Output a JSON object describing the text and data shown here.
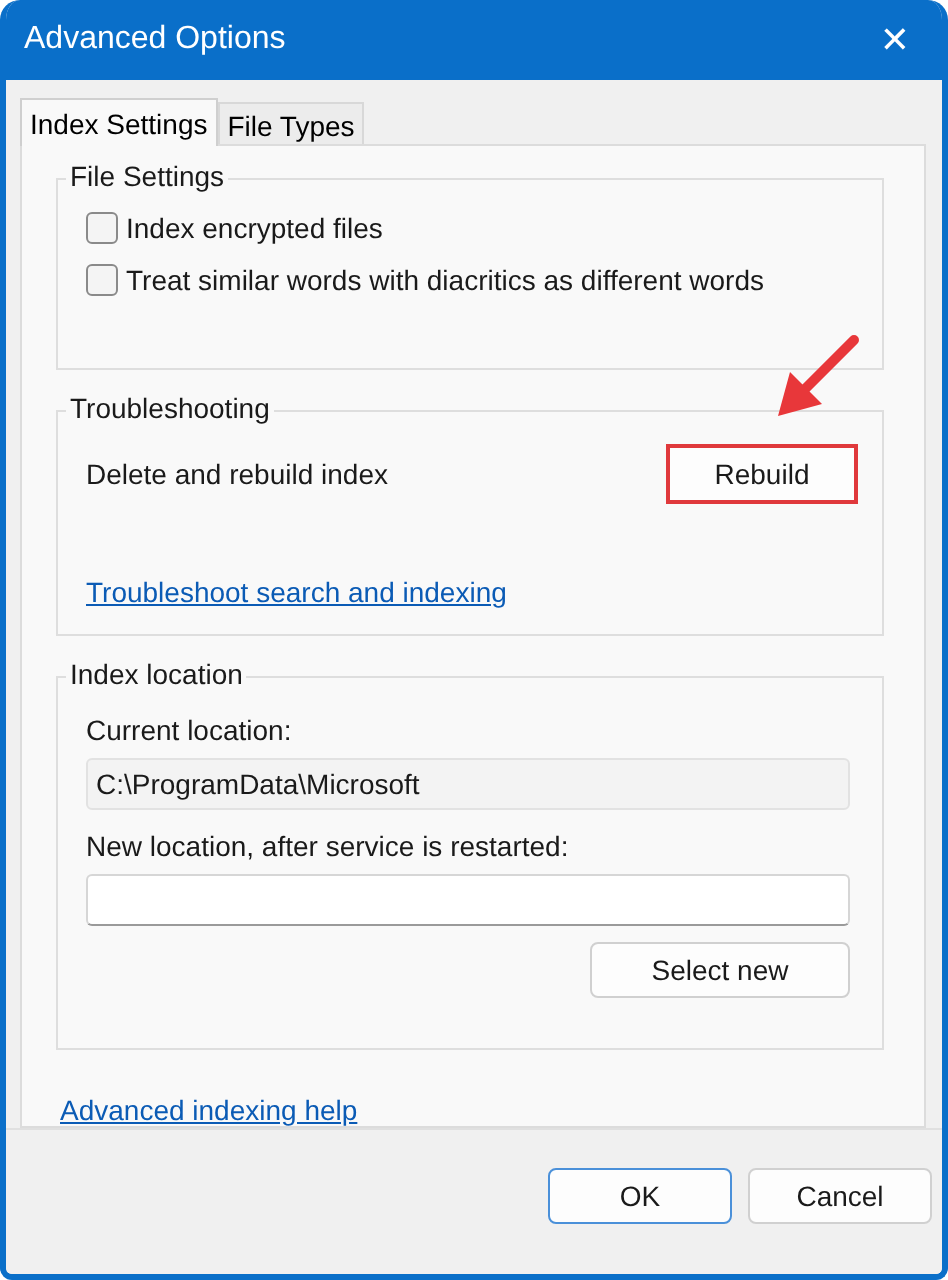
{
  "window": {
    "title": "Advanced Options",
    "close": "✕"
  },
  "tabs": [
    {
      "label": "Index Settings",
      "selected": true
    },
    {
      "label": "File Types",
      "selected": false
    }
  ],
  "file_settings": {
    "title": "File Settings",
    "options": [
      {
        "label": "Index encrypted files",
        "checked": false
      },
      {
        "label": "Treat similar words with diacritics as different words",
        "checked": false
      }
    ]
  },
  "troubleshooting": {
    "title": "Troubleshooting",
    "label": "Delete and rebuild index",
    "button": {
      "label": "Rebuild",
      "highlighted": true
    },
    "link": "Troubleshoot search and indexing"
  },
  "index_location": {
    "title": "Index location",
    "current_label": "Current location:",
    "current_value": "C:\\ProgramData\\Microsoft",
    "new_label": "New location, after service is restarted:",
    "button": "Select new"
  },
  "help_link": "Advanced indexing help",
  "buttons": [
    {
      "label": "OK",
      "kind": "default"
    },
    {
      "label": "Cancel",
      "kind": "normal"
    }
  ]
}
